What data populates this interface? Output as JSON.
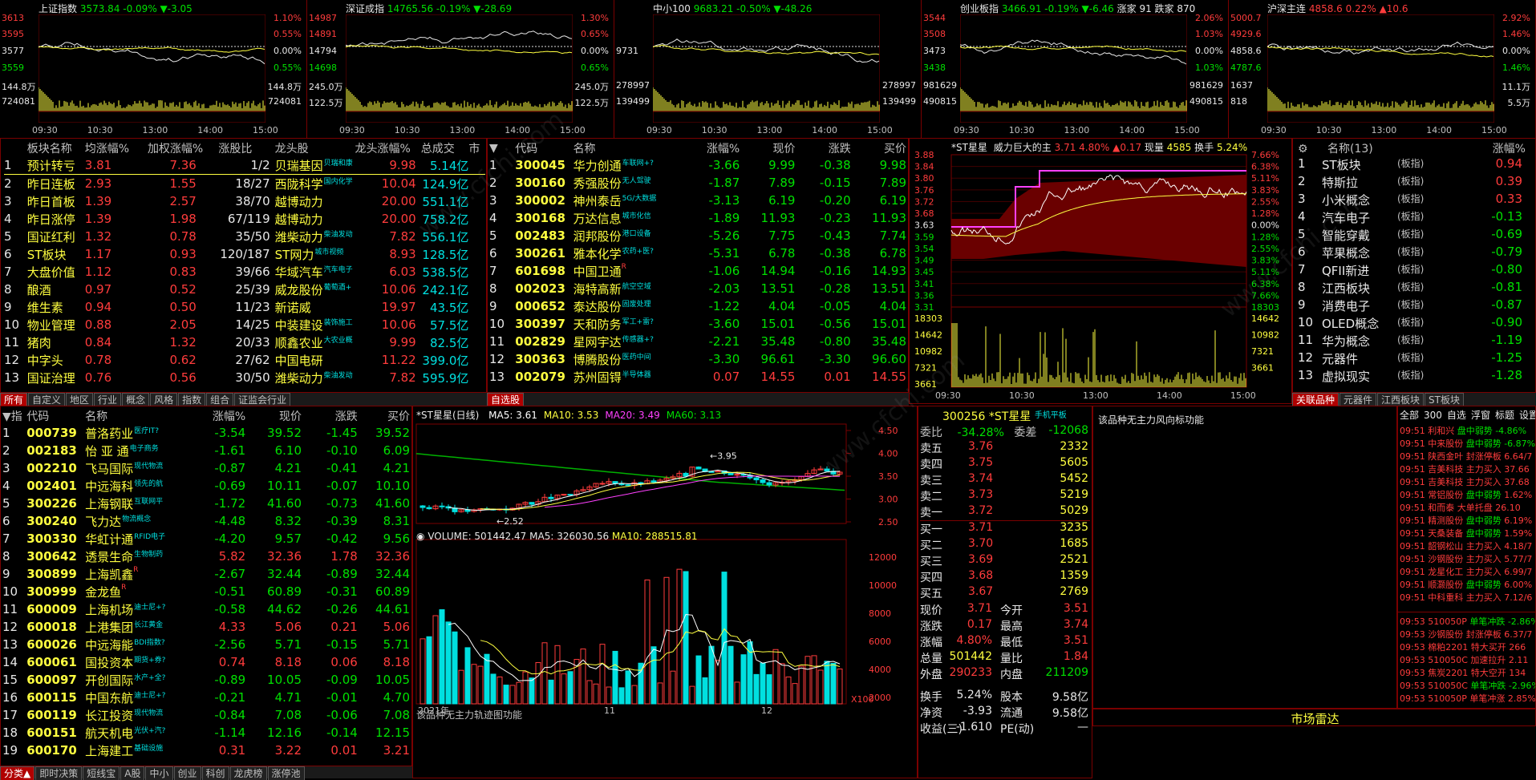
{
  "indices": [
    {
      "name": "上证指数",
      "price": "3573.84",
      "pct": "-0.09%",
      "chg": "▼-3.05",
      "left_labels": [
        "3613",
        "3595",
        "3577",
        "3559",
        "144.8万",
        "724081"
      ],
      "right_labels": [
        "1.10%",
        "0.55%",
        "0.00%",
        "0.55%",
        "144.8万",
        "724081"
      ]
    },
    {
      "name": "深证成指",
      "price": "14765.56",
      "pct": "-0.19%",
      "chg": "▼-28.69",
      "left_labels": [
        "14987",
        "14891",
        "14794",
        "14698",
        "245.0万",
        "122.5万"
      ],
      "right_labels": [
        "1.30%",
        "0.65%",
        "0.00%",
        "0.65%",
        "245.0万",
        "122.5万"
      ]
    },
    {
      "name": "中小100",
      "price": "9683.21",
      "pct": "-0.50%",
      "chg": "▼-48.26",
      "left_labels": [
        "",
        "",
        "9731",
        "",
        "278997",
        "139499"
      ],
      "right_labels": [
        "",
        "",
        "",
        "",
        "278997",
        "139499"
      ]
    },
    {
      "name": "创业板指",
      "price": "3466.91",
      "pct": "-0.19%",
      "chg": "▼-6.46",
      "extra": "涨家 91 跌家 870",
      "left_labels": [
        "3544",
        "3508",
        "3473",
        "3438",
        "981629",
        "490815"
      ],
      "right_labels": [
        "2.06%",
        "1.03%",
        "0.00%",
        "1.03%",
        "981629",
        "490815"
      ]
    },
    {
      "name": "沪深主连",
      "price": "4858.6",
      "pct": "0.22%",
      "chg": "▲10.6",
      "left_labels": [
        "5000.7",
        "4929.6",
        "4858.6",
        "4787.6",
        "1637",
        "818"
      ],
      "right_labels": [
        "2.92%",
        "1.46%",
        "0.00%",
        "1.46%",
        "11.1万",
        "5.5万"
      ]
    }
  ],
  "time_ticks": [
    "09:30",
    "10:30",
    "13:00",
    "14:00",
    "15:00"
  ],
  "sector_table": {
    "headers": [
      "板块名称",
      "均涨幅%",
      "加权涨幅%",
      "涨股比",
      "龙头股",
      "龙头涨幅%",
      "总成交",
      "市"
    ],
    "rows": [
      [
        "预计转亏",
        "3.81",
        "7.36",
        "1/2",
        "贝瑞基因",
        "贝瑞和康",
        "9.98",
        "5.14亿"
      ],
      [
        "昨日连板",
        "2.93",
        "1.55",
        "18/27",
        "西陇科学",
        "国内化学",
        "10.04",
        "124.9亿"
      ],
      [
        "昨日首板",
        "1.39",
        "2.57",
        "38/70",
        "越博动力",
        "",
        "20.00",
        "551.1亿"
      ],
      [
        "昨日涨停",
        "1.39",
        "1.98",
        "67/119",
        "越博动力",
        "",
        "20.00",
        "758.2亿"
      ],
      [
        "国证红利",
        "1.32",
        "0.78",
        "35/50",
        "潍柴动力",
        "柴油发动",
        "7.82",
        "556.1亿"
      ],
      [
        "ST板块",
        "1.17",
        "0.93",
        "120/187",
        "ST网力",
        "城市视频",
        "8.93",
        "128.5亿"
      ],
      [
        "大盘价值",
        "1.12",
        "0.83",
        "39/66",
        "华域汽车",
        "汽车电子",
        "6.03",
        "538.5亿"
      ],
      [
        "酿酒",
        "0.97",
        "0.52",
        "25/39",
        "威龙股份",
        "葡萄酒+",
        "10.06",
        "242.1亿"
      ],
      [
        "维生素",
        "0.94",
        "0.50",
        "11/23",
        "新诺威",
        "",
        "19.97",
        "43.5亿"
      ],
      [
        "物业管理",
        "0.88",
        "2.05",
        "14/25",
        "中装建设",
        "装饰施工",
        "10.06",
        "57.5亿"
      ],
      [
        "猪肉",
        "0.84",
        "1.32",
        "20/33",
        "顺鑫农业",
        "大农业概",
        "9.99",
        "82.5亿"
      ],
      [
        "中字头",
        "0.78",
        "0.62",
        "27/62",
        "中国电研",
        "",
        "11.22",
        "399.0亿"
      ],
      [
        "国证治理",
        "0.76",
        "0.56",
        "30/50",
        "潍柴动力",
        "柴油发动",
        "7.82",
        "595.9亿"
      ]
    ]
  },
  "sector_tabs": [
    "所有",
    "自定义",
    "地区",
    "行业",
    "概念",
    "风格",
    "指数",
    "组合",
    "证监会行业"
  ],
  "watch_table": {
    "headers": [
      "代码",
      "名称",
      "涨幅%",
      "现价",
      "涨跌",
      "买价"
    ],
    "rows": [
      [
        "300045",
        "华力创通",
        "车联网+?",
        "-3.66",
        "9.99",
        "-0.38",
        "9.98"
      ],
      [
        "300160",
        "秀强股份",
        "无人驾驶",
        "-1.87",
        "7.89",
        "-0.15",
        "7.89"
      ],
      [
        "300002",
        "神州泰岳",
        "5G/大数据",
        "-3.13",
        "6.19",
        "-0.20",
        "6.19"
      ],
      [
        "300168",
        "万达信息",
        "城市化信",
        "-1.89",
        "11.93",
        "-0.23",
        "11.93"
      ],
      [
        "002483",
        "润邦股份",
        "港口设备",
        "-5.26",
        "7.75",
        "-0.43",
        "7.74"
      ],
      [
        "300261",
        "雅本化学",
        "农药+医?",
        "-5.31",
        "6.78",
        "-0.38",
        "6.78"
      ],
      [
        "601698",
        "中国卫通",
        "R",
        "-1.06",
        "14.94",
        "-0.16",
        "14.93"
      ],
      [
        "002023",
        "海特高新",
        "航空空域",
        "-2.03",
        "13.51",
        "-0.28",
        "13.51"
      ],
      [
        "000652",
        "泰达股份",
        "固废处理",
        "-1.22",
        "4.04",
        "-0.05",
        "4.04"
      ],
      [
        "300397",
        "天和防务",
        "军工+雷?",
        "-3.60",
        "15.01",
        "-0.56",
        "15.01"
      ],
      [
        "002829",
        "星网宇达",
        "传感器+?",
        "-2.21",
        "35.48",
        "-0.80",
        "35.48"
      ],
      [
        "300363",
        "博腾股份",
        "医药中间",
        "-3.30",
        "96.61",
        "-3.30",
        "96.60"
      ],
      [
        "002079",
        "苏州固锝",
        "半导体器",
        "0.07",
        "14.55",
        "0.01",
        "14.55"
      ]
    ]
  },
  "watch_tab": "自选股",
  "intraday": {
    "title": "*ST星星",
    "subtitle": "威力巨大的主",
    "price": "3.71",
    "pct": "4.80%",
    "chg": "▲0.17",
    "vol_label": "现量",
    "vol": "4585",
    "turn_label": "换手",
    "turn": "5.24%",
    "left": [
      "3.88",
      "3.84",
      "3.80",
      "3.76",
      "3.72",
      "3.68",
      "3.63",
      "3.59",
      "3.54",
      "3.49",
      "3.45",
      "3.41",
      "3.36",
      "3.31",
      "18303",
      "14642",
      "10982",
      "7321",
      "3661"
    ],
    "right": [
      "7.66%",
      "6.38%",
      "5.11%",
      "3.83%",
      "2.55%",
      "1.28%",
      "0.00%",
      "1.28%",
      "2.55%",
      "3.83%",
      "5.11%",
      "6.38%",
      "7.66%",
      "18303",
      "14642",
      "10982",
      "7321",
      "3661"
    ],
    "ticks": [
      "09:30",
      "10:30",
      "13:00",
      "14:00",
      "15:00"
    ]
  },
  "concepts": {
    "title": "名称(13)",
    "col": "涨幅%",
    "rows": [
      [
        "ST板块",
        "(板指)",
        "0.94"
      ],
      [
        "特斯拉",
        "(板指)",
        "0.39"
      ],
      [
        "小米概念",
        "(板指)",
        "0.33"
      ],
      [
        "汽车电子",
        "(板指)",
        "-0.13"
      ],
      [
        "智能穿戴",
        "(板指)",
        "-0.69"
      ],
      [
        "苹果概念",
        "(板指)",
        "-0.79"
      ],
      [
        "QFII新进",
        "(板指)",
        "-0.80"
      ],
      [
        "江西板块",
        "(板指)",
        "-0.81"
      ],
      [
        "消费电子",
        "(板指)",
        "-0.87"
      ],
      [
        "OLED概念",
        "(板指)",
        "-0.90"
      ],
      [
        "华为概念",
        "(板指)",
        "-1.19"
      ],
      [
        "元器件",
        "(板指)",
        "-1.25"
      ],
      [
        "虚拟现实",
        "(板指)",
        "-1.28"
      ]
    ],
    "tabs": [
      "关联品种",
      "元器件",
      "江西板块",
      "ST板块"
    ]
  },
  "stock_list": {
    "headers": [
      "代码",
      "名称",
      "涨幅%",
      "现价",
      "涨跌",
      "买价"
    ],
    "rows": [
      [
        "000739",
        "普洛药业",
        "医疗IT?",
        "-3.54",
        "39.52",
        "-1.45",
        "39.52"
      ],
      [
        "002183",
        "怡 亚 通",
        "电子商务",
        "-1.61",
        "6.10",
        "-0.10",
        "6.09"
      ],
      [
        "002210",
        "飞马国际",
        "现代物流",
        "-0.87",
        "4.21",
        "-0.41",
        "4.21"
      ],
      [
        "002401",
        "中远海科",
        "领先的航",
        "-0.69",
        "10.11",
        "-0.07",
        "10.10"
      ],
      [
        "300226",
        "上海钢联",
        "互联网平",
        "-1.72",
        "41.60",
        "-0.73",
        "41.60"
      ],
      [
        "300240",
        "飞力达",
        "物流概念",
        "-4.48",
        "8.32",
        "-0.39",
        "8.31"
      ],
      [
        "300330",
        "华虹计通",
        "RFID电子",
        "-4.20",
        "9.57",
        "-0.42",
        "9.56"
      ],
      [
        "300642",
        "透景生命",
        "生物制药",
        "5.82",
        "32.36",
        "1.78",
        "32.36"
      ],
      [
        "300899",
        "上海凯鑫",
        "R",
        "-2.67",
        "32.44",
        "-0.89",
        "32.44"
      ],
      [
        "300999",
        "金龙鱼",
        "R",
        "-0.51",
        "60.89",
        "-0.31",
        "60.89"
      ],
      [
        "600009",
        "上海机场",
        "迪士尼+?",
        "-0.58",
        "44.62",
        "-0.26",
        "44.61"
      ],
      [
        "600018",
        "上港集团",
        "长江黄金",
        "4.33",
        "5.06",
        "0.21",
        "5.06"
      ],
      [
        "600026",
        "中远海能",
        "BDI指数?",
        "-2.56",
        "5.71",
        "-0.15",
        "5.71"
      ],
      [
        "600061",
        "国投资本",
        "期货+券?",
        "0.74",
        "8.18",
        "0.06",
        "8.18"
      ],
      [
        "600097",
        "开创国际",
        "水产+全?",
        "-0.89",
        "10.05",
        "-0.09",
        "10.05"
      ],
      [
        "600115",
        "中国东航",
        "迪士尼+?",
        "-0.21",
        "4.71",
        "-0.01",
        "4.70"
      ],
      [
        "600119",
        "长江投资",
        "现代物流",
        "-0.84",
        "7.08",
        "-0.06",
        "7.08"
      ],
      [
        "600151",
        "航天机电",
        "光伏+汽?",
        "-1.14",
        "12.16",
        "-0.14",
        "12.15"
      ],
      [
        "600170",
        "上海建工",
        "基础设施",
        "0.31",
        "3.22",
        "0.01",
        "3.21"
      ]
    ],
    "tabs": [
      "分类▲",
      "即时决策",
      "短线宝",
      "A股",
      "中小",
      "创业",
      "科创",
      "龙虎榜",
      "涨停池"
    ]
  },
  "kline": {
    "title": "*ST星星(日线)",
    "ma": [
      {
        "label": "MA5: 3.61",
        "color": "#ffffff"
      },
      {
        "label": "MA10: 3.53",
        "color": "#ffff40"
      },
      {
        "label": "MA20: 3.49",
        "color": "#ff40ff"
      },
      {
        "label": "MA60: 3.13",
        "color": "#00e000"
      }
    ],
    "price_axis": [
      "4.50",
      "4.00",
      "3.50",
      "3.00",
      "2.50"
    ],
    "high_mark": "3.95",
    "low_mark": "2.52",
    "vol_title": "VOLUME: 501442.47",
    "vol_ma5": "MA5: 326030.56",
    "vol_ma10": "MA10: 288515.81",
    "vol_axis": [
      "12000",
      "10000",
      "8000",
      "6000",
      "4000",
      "2000"
    ],
    "vol_unit": "X100",
    "dates": [
      "2021年",
      "11",
      "12"
    ],
    "note": "该品种无主力轨迹图功能"
  },
  "quote": {
    "code": "300256",
    "name": "*ST星星",
    "tag": "手机平板",
    "ratio_label": "委比",
    "ratio": "-34.28%",
    "diff_label": "委差",
    "diff": "-12068",
    "asks": [
      [
        "卖五",
        "3.76",
        "2332"
      ],
      [
        "卖四",
        "3.75",
        "5605"
      ],
      [
        "卖三",
        "3.74",
        "5452"
      ],
      [
        "卖二",
        "3.73",
        "5219"
      ],
      [
        "卖一",
        "3.72",
        "5029"
      ]
    ],
    "bids": [
      [
        "买一",
        "3.71",
        "3235"
      ],
      [
        "买二",
        "3.70",
        "1685"
      ],
      [
        "买三",
        "3.69",
        "2521"
      ],
      [
        "买四",
        "3.68",
        "1359"
      ],
      [
        "买五",
        "3.67",
        "2769"
      ]
    ],
    "stats": [
      [
        "现价",
        "3.71",
        "今开",
        "3.51"
      ],
      [
        "涨跌",
        "0.17",
        "最高",
        "3.74"
      ],
      [
        "涨幅",
        "4.80%",
        "最低",
        "3.51"
      ],
      [
        "总量",
        "501442",
        "量比",
        "1.84"
      ],
      [
        "外盘",
        "290233",
        "内盘",
        "211209"
      ]
    ],
    "stats2": [
      [
        "换手",
        "5.24%",
        "股本",
        "9.58亿"
      ],
      [
        "净资",
        "-3.93",
        "流通",
        "9.58亿"
      ],
      [
        "收益(三)",
        "-1.610",
        "PE(动)",
        "—"
      ]
    ]
  },
  "wind_note": "该品种无主力风向标功能",
  "radar_title": "市场雷达",
  "radar_tabs": [
    "全部",
    "300",
    "自选",
    "浮窗",
    "标题",
    "设置"
  ],
  "radar_list": [
    [
      "09:51",
      "利和兴",
      "盘中弱势",
      "-4.86%"
    ],
    [
      "09:51",
      "中来股份",
      "盘中弱势",
      "-6.87%"
    ],
    [
      "09:51",
      "陕西金叶",
      "封涨停板",
      "6.64/7"
    ],
    [
      "09:51",
      "吉美科技",
      "主力买入",
      "37.66"
    ],
    [
      "09:51",
      "吉美科技",
      "主力买入",
      "37.68"
    ],
    [
      "09:51",
      "常铝股份",
      "盘中弱势",
      "1.62%"
    ],
    [
      "09:51",
      "和而泰",
      "大单托盘",
      "26.10"
    ],
    [
      "09:51",
      "精测股份",
      "盘中弱势",
      "6.19%"
    ],
    [
      "09:51",
      "天桑装备",
      "盘中弱势",
      "1.59%"
    ],
    [
      "09:51",
      "韶钢松山",
      "主力买入",
      "4.18/7"
    ],
    [
      "09:51",
      "沙钢股份",
      "主力买入",
      "5.77/7"
    ],
    [
      "09:51",
      "龙星化工",
      "主力买入",
      "6.99/7"
    ],
    [
      "09:51",
      "顺灏股份",
      "盘中弱势",
      "6.00%"
    ],
    [
      "09:51",
      "中科重科",
      "主力买入",
      "7.12/6"
    ]
  ],
  "radar_list2": [
    [
      "09:53",
      "510050P",
      "单笔冲跌",
      "-2.86%"
    ],
    [
      "09:53",
      "沙钢股份",
      "封涨停板",
      "6.37/7"
    ],
    [
      "09:53",
      "棉粕2201",
      "特大买开",
      "266"
    ],
    [
      "09:53",
      "510050C",
      "加速拉升",
      "2.11"
    ],
    [
      "09:53",
      "焦炭2201",
      "特大空开",
      "134"
    ],
    [
      "09:53",
      "510050C",
      "单笔冲跌",
      "-2.96%"
    ],
    [
      "09:53",
      "510050P",
      "单笔冲涨",
      "2.85%"
    ]
  ]
}
